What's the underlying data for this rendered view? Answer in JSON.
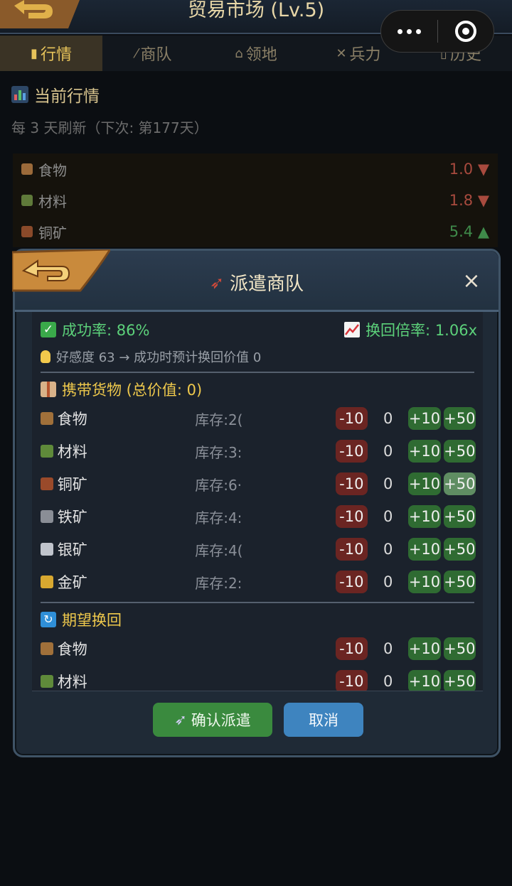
{
  "app": {
    "title": "贸易市场 (Lv.5)"
  },
  "tabs": [
    {
      "icon": "bar-chart-icon",
      "label": "行情"
    },
    {
      "icon": "caravan-icon",
      "label": "商队"
    },
    {
      "icon": "territory-icon",
      "label": "领地"
    },
    {
      "icon": "crossed-swords-icon",
      "label": "兵力"
    },
    {
      "icon": "scroll-icon",
      "label": "历史"
    }
  ],
  "market": {
    "title": "当前行情",
    "refresh": "每 3 天刷新（下次: 第177天）",
    "rows": [
      {
        "name": "食物",
        "price": "1.0",
        "trend": "▼"
      },
      {
        "name": "材料",
        "price": "1.8",
        "trend": "▼"
      },
      {
        "name": "铜矿",
        "price": "5.4",
        "trend": "▲"
      }
    ]
  },
  "dialog": {
    "title": "派遣商队",
    "close": "×",
    "success_label": "成功率: 86%",
    "rate_label": "换回倍率: 1.06x",
    "hint": "好感度 63 → 成功时预计换回价值 0",
    "carry_title": "携带货物 (总价值: 0)",
    "expect_title": "期望换回",
    "buttons": {
      "minus10": "-10",
      "plus10": "+10",
      "plus50": "+50"
    },
    "carry_items": [
      {
        "name": "食物",
        "stock": "库存:2(",
        "qty": "0"
      },
      {
        "name": "材料",
        "stock": "库存:3:",
        "qty": "0"
      },
      {
        "name": "铜矿",
        "stock": "库存:6·",
        "qty": "0"
      },
      {
        "name": "铁矿",
        "stock": "库存:4:",
        "qty": "0"
      },
      {
        "name": "银矿",
        "stock": "库存:4(",
        "qty": "0"
      },
      {
        "name": "金矿",
        "stock": "库存:2:",
        "qty": "0"
      }
    ],
    "expect_items": [
      {
        "name": "食物",
        "qty": "0"
      },
      {
        "name": "材料",
        "qty": "0"
      }
    ],
    "confirm_label": "确认派遣",
    "cancel_label": "取消"
  },
  "colors": {
    "accent_gold": "#efc94c",
    "success_green": "#5cd17a",
    "minus_red": "#6b2522",
    "plus_green": "#2f6b32",
    "confirm_green": "#3a8a3e",
    "cancel_blue": "#3e84bf"
  }
}
